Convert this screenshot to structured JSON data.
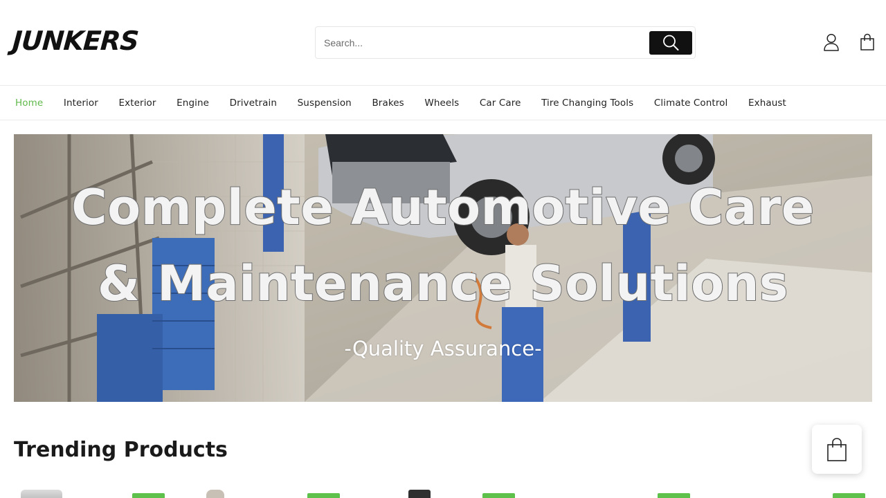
{
  "header": {
    "logo_text": "JUNKERS",
    "search": {
      "placeholder": "Search...",
      "value": ""
    },
    "icons": {
      "search": "search-icon",
      "account": "user-icon",
      "cart": "shopping-bag-icon"
    }
  },
  "nav": {
    "items": [
      {
        "label": "Home",
        "active": true
      },
      {
        "label": "Interior",
        "active": false
      },
      {
        "label": "Exterior",
        "active": false
      },
      {
        "label": "Engine",
        "active": false
      },
      {
        "label": "Drivetrain",
        "active": false
      },
      {
        "label": "Suspension",
        "active": false
      },
      {
        "label": "Brakes",
        "active": false
      },
      {
        "label": "Wheels",
        "active": false
      },
      {
        "label": "Car Care",
        "active": false
      },
      {
        "label": "Tire Changing Tools",
        "active": false
      },
      {
        "label": "Climate Control",
        "active": false
      },
      {
        "label": "Exhaust",
        "active": false
      }
    ]
  },
  "hero": {
    "title_line1": "Complete Automotive Care",
    "title_line2": "& Maintenance Solutions",
    "subtitle": "-Quality Assurance-"
  },
  "trending": {
    "title": "Trending Products",
    "badge_color": "#5dc14c"
  },
  "floating_cart": {
    "icon": "shopping-bag-icon"
  },
  "colors": {
    "accent": "#5fb94a",
    "dark": "#111111"
  }
}
